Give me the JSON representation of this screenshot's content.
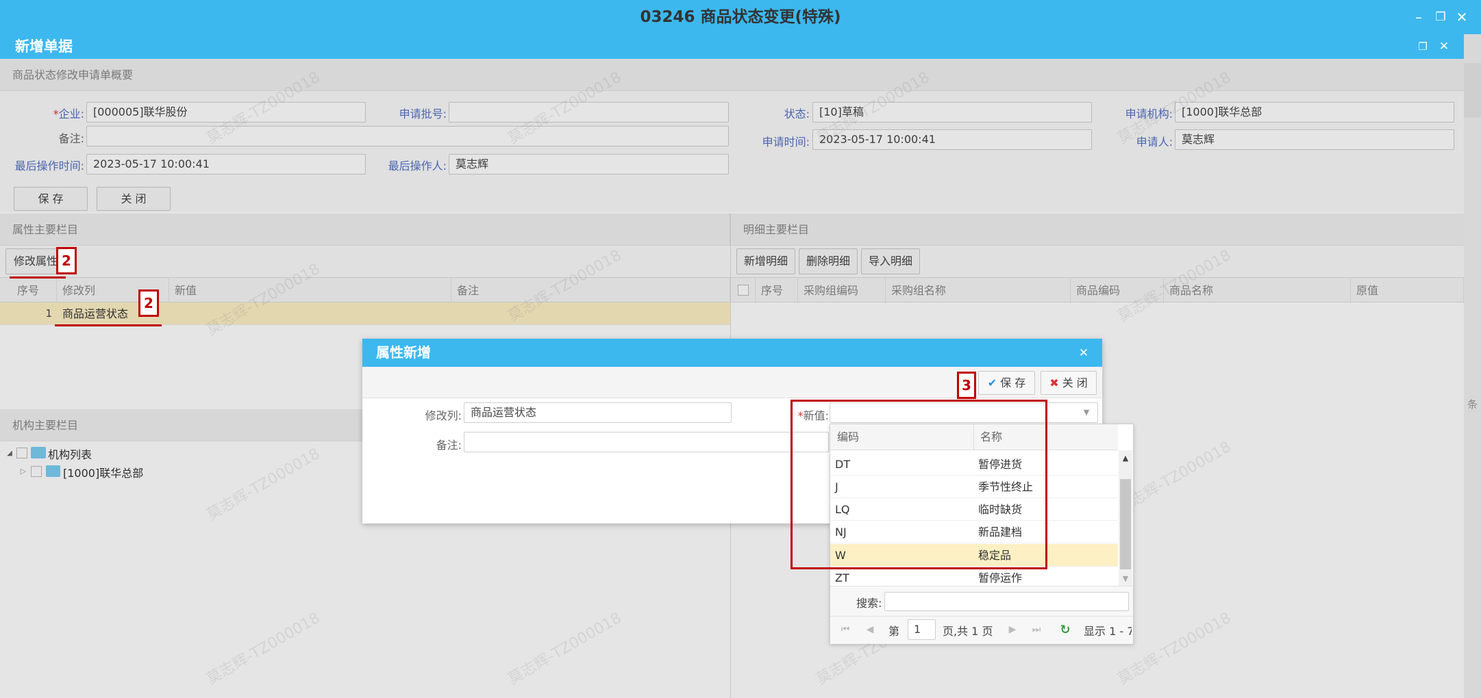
{
  "app": {
    "title": "03246 商品状态变更(特殊)",
    "inner_title": "新增单据"
  },
  "summary": {
    "section_title": "商品状态修改申请单概要",
    "fields": {
      "company_label": "企业:",
      "company_value": "[000005]联华股份",
      "batch_label": "申请批号:",
      "batch_value": "",
      "status_label": "状态:",
      "status_value": "[10]草稿",
      "org_label": "申请机构:",
      "org_value": "[1000]联华总部",
      "remark_label": "备注:",
      "remark_value": "",
      "apply_time_label": "申请时间:",
      "apply_time_value": "2023-05-17 10:00:41",
      "applicant_label": "申请人:",
      "applicant_value": "莫志辉",
      "last_op_time_label": "最后操作时间:",
      "last_op_time_value": "2023-05-17 10:00:41",
      "last_operator_label": "最后操作人:",
      "last_operator_value": "莫志辉"
    },
    "save_label": "保 存",
    "close_label": "关 闭"
  },
  "attr_panel": {
    "title": "属性主要栏目",
    "modify_button": "修改属性",
    "columns": [
      "序号",
      "修改列",
      "新值",
      "备注"
    ],
    "rows": [
      {
        "no": "1",
        "column": "商品运营状态",
        "new_value": "",
        "remark": ""
      }
    ]
  },
  "detail_panel": {
    "title": "明细主要栏目",
    "buttons": [
      "新增明细",
      "删除明细",
      "导入明细"
    ],
    "columns": [
      "序号",
      "采购组编码",
      "采购组名称",
      "商品编码",
      "商品名称",
      "原值"
    ]
  },
  "org_panel": {
    "title": "机构主要栏目",
    "tree": [
      {
        "label": "机构列表"
      },
      {
        "label": "[1000]联华总部"
      }
    ]
  },
  "dialog": {
    "title": "属性新增",
    "save_label": "保 存",
    "close_label": "关 闭",
    "modify_col_label": "修改列:",
    "modify_col_value": "商品运营状态",
    "remark_label": "备注:",
    "remark_value": "",
    "new_value_label": "新值:",
    "new_value_value": ""
  },
  "dropdown": {
    "columns": [
      "编码",
      "名称"
    ],
    "rows": [
      {
        "code": "DT",
        "name": "暂停进货"
      },
      {
        "code": "J",
        "name": "季节性终止"
      },
      {
        "code": "LQ",
        "name": "临时缺货"
      },
      {
        "code": "NJ",
        "name": "新品建档"
      },
      {
        "code": "W",
        "name": "稳定品"
      },
      {
        "code": "ZT",
        "name": "暂停运作"
      }
    ],
    "selected_code": "W",
    "search_label": "搜索:",
    "search_value": "",
    "pager": {
      "page_prefix": "第",
      "page": "1",
      "page_suffix": "页,共 1 页",
      "display": "显示 1 - 7"
    }
  },
  "annotations": {
    "badge_modify": "2",
    "badge_row": "2",
    "badge_dialog": "3"
  },
  "watermark": "莫志辉-TZ000018",
  "edge_text": "条",
  "colors": {
    "title_bar": "#3cb8ef",
    "selected_row": "#fdf0c4",
    "annotation": "#c00000"
  }
}
